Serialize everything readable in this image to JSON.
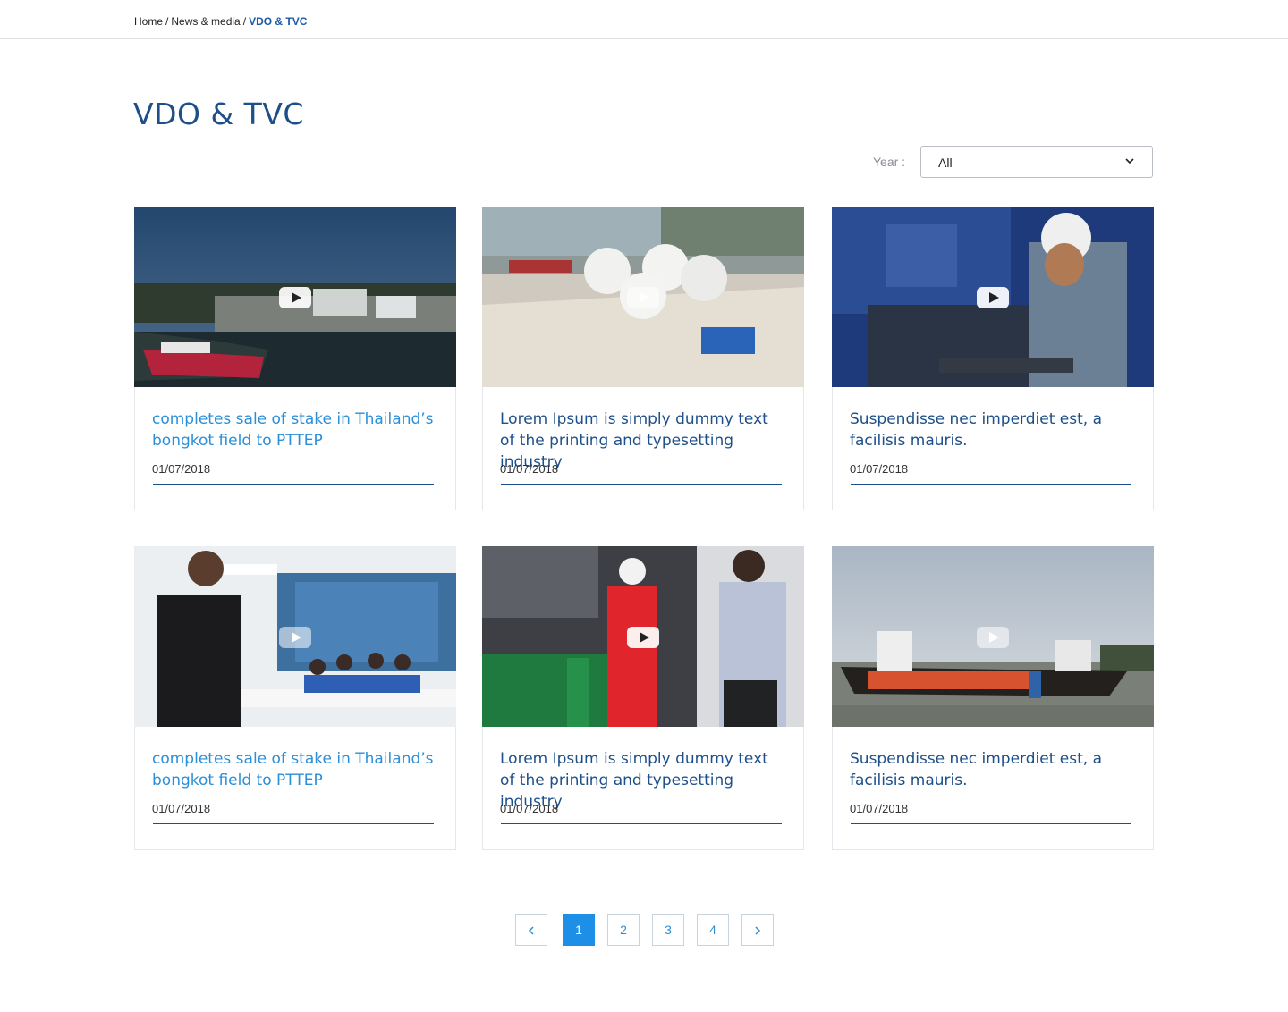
{
  "breadcrumb": {
    "home": "Home",
    "section": "News & media",
    "separator": "/",
    "current": "VDO & TVC"
  },
  "page_title": "VDO & TVC",
  "filter": {
    "label": "Year :",
    "value": "All"
  },
  "cards": [
    {
      "title": "completes sale of stake in Thailand’s bongkot field to PTTEP",
      "date": "01/07/2018"
    },
    {
      "title": "Lorem Ipsum is simply dummy text of the printing and typesetting industry",
      "date": "01/07/2018"
    },
    {
      "title": "Suspendisse nec imperdiet est, a facilisis mauris.",
      "date": "01/07/2018"
    },
    {
      "title": "completes sale of stake in Thailand’s bongkot field to PTTEP",
      "date": "01/07/2018"
    },
    {
      "title": "Lorem Ipsum is simply dummy text of the printing and typesetting industry",
      "date": "01/07/2018"
    },
    {
      "title": "Suspendisse nec imperdiet est, a facilisis mauris."
    }
  ],
  "pagination": {
    "prev": "‹",
    "next": "›",
    "pages": [
      "1",
      "2",
      "3",
      "4"
    ],
    "current_page": "1"
  },
  "colors": {
    "brand_blue": "#1d4f8a",
    "link_blue": "#2b8fd8",
    "active_page": "#1d8fe6"
  }
}
